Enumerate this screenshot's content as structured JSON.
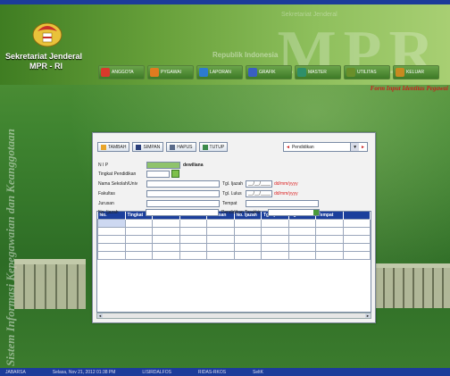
{
  "app": {
    "org_line1": "Sekretariat Jenderal",
    "org_line2": "MPR - RI",
    "banner_mpr": "MPR",
    "banner_subtitle": "Republik Indonesia",
    "banner_top": "Sekretariat Jenderal"
  },
  "menu": [
    {
      "label": "ANGGOTA",
      "icon": "people-icon",
      "color": "#d9392c"
    },
    {
      "label": "PYGAWAI",
      "icon": "person-icon",
      "color": "#e07b1f"
    },
    {
      "label": "LAPORAN",
      "icon": "report-icon",
      "color": "#2d7bd0"
    },
    {
      "label": "GRAFIK",
      "icon": "chart-icon",
      "color": "#3a5fc0"
    },
    {
      "label": "MASTER",
      "icon": "database-icon",
      "color": "#2f8f6a"
    },
    {
      "label": "UTILITAS",
      "icon": "tools-icon",
      "color": "#6a8f2a"
    },
    {
      "label": "KELUAR",
      "icon": "exit-icon",
      "color": "#c88a20"
    }
  ],
  "form_title": "Form Input Identitas Pegawai",
  "side_text": "Sistem Informasi Kepegawaian dan Keanggotaan",
  "toolbar": {
    "tambah": "TAMBAH",
    "simpan": "SIMPAN",
    "hapus": "HAPUS",
    "tutup": "TUTUP"
  },
  "combo": {
    "value": "Pendidikan"
  },
  "form": {
    "nip_label": "N I P",
    "nip_name": "dewiliana",
    "tingkat_label": "Tingkat Pendidikan",
    "sekolah_label": "Nama Sekolah/Univ",
    "fakultas_label": "Fakultas",
    "jurusan_label": "Jurusan",
    "noijazah_label": "No. Ijazah",
    "tglijazah_label": "Tgl. Ijazah",
    "tgllulus_label": "Tgl. Lulus",
    "tempat_label": "Tempat",
    "terakhir_label": "Pendidikan Terakhir",
    "date_value": "__/__/____",
    "date_hint": "dd/mm/yyyy"
  },
  "table": {
    "columns": [
      "No.",
      "Tingkat",
      "Nama",
      "Fakultas",
      "Jurusan",
      "No. Ijazah",
      "Tgl. Ijazah",
      "Tgl. Lulus",
      "Tempat",
      ""
    ]
  },
  "status": {
    "items": [
      "JABARSA",
      "Selasa, Nov 21, 2012 01:38 PM",
      "LISIRDALFOS",
      "RIDAS-RKOS",
      "SeltK"
    ]
  }
}
